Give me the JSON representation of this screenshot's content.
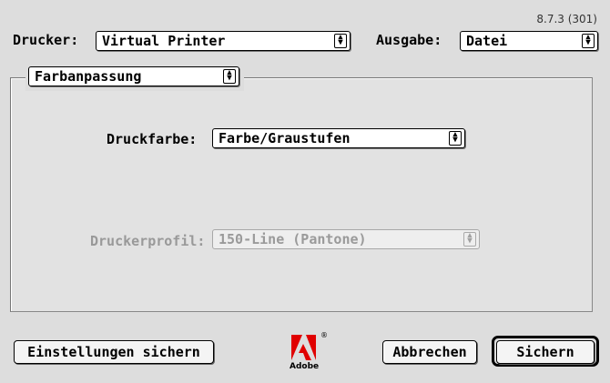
{
  "version": "8.7.3 (301)",
  "printer": {
    "label": "Drucker:",
    "value": "Virtual Printer"
  },
  "output": {
    "label": "Ausgabe:",
    "value": "Datei"
  },
  "panel_selector": {
    "value": "Farbanpassung"
  },
  "ink": {
    "label": "Druckfarbe:",
    "value": "Farbe/Graustufen"
  },
  "profile": {
    "label": "Druckerprofil:",
    "value": "150-Line (Pantone)",
    "enabled": false
  },
  "buttons": {
    "save_settings": "Einstellungen sichern",
    "cancel": "Abbrechen",
    "save": "Sichern"
  },
  "logo": {
    "text": "Adobe",
    "registered": "®"
  },
  "icons": {
    "popup_arrows": "updown-arrows-icon",
    "logo": "adobe-logo-icon"
  }
}
